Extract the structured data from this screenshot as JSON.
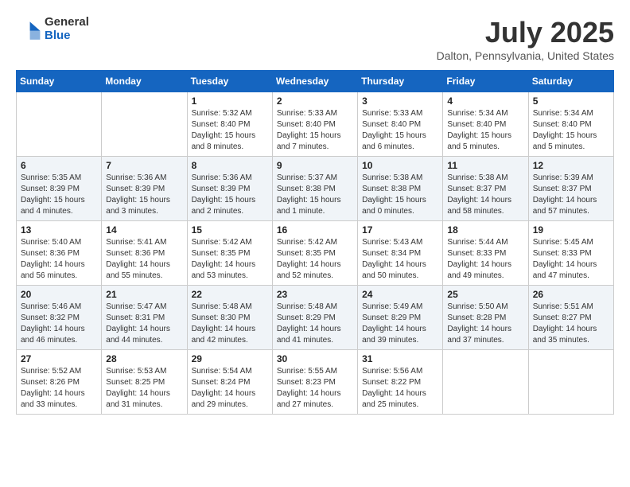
{
  "header": {
    "logo_general": "General",
    "logo_blue": "Blue",
    "month_title": "July 2025",
    "location": "Dalton, Pennsylvania, United States"
  },
  "weekdays": [
    "Sunday",
    "Monday",
    "Tuesday",
    "Wednesday",
    "Thursday",
    "Friday",
    "Saturday"
  ],
  "weeks": [
    [
      {
        "day": "",
        "info": ""
      },
      {
        "day": "",
        "info": ""
      },
      {
        "day": "1",
        "info": "Sunrise: 5:32 AM\nSunset: 8:40 PM\nDaylight: 15 hours and 8 minutes."
      },
      {
        "day": "2",
        "info": "Sunrise: 5:33 AM\nSunset: 8:40 PM\nDaylight: 15 hours and 7 minutes."
      },
      {
        "day": "3",
        "info": "Sunrise: 5:33 AM\nSunset: 8:40 PM\nDaylight: 15 hours and 6 minutes."
      },
      {
        "day": "4",
        "info": "Sunrise: 5:34 AM\nSunset: 8:40 PM\nDaylight: 15 hours and 5 minutes."
      },
      {
        "day": "5",
        "info": "Sunrise: 5:34 AM\nSunset: 8:40 PM\nDaylight: 15 hours and 5 minutes."
      }
    ],
    [
      {
        "day": "6",
        "info": "Sunrise: 5:35 AM\nSunset: 8:39 PM\nDaylight: 15 hours and 4 minutes."
      },
      {
        "day": "7",
        "info": "Sunrise: 5:36 AM\nSunset: 8:39 PM\nDaylight: 15 hours and 3 minutes."
      },
      {
        "day": "8",
        "info": "Sunrise: 5:36 AM\nSunset: 8:39 PM\nDaylight: 15 hours and 2 minutes."
      },
      {
        "day": "9",
        "info": "Sunrise: 5:37 AM\nSunset: 8:38 PM\nDaylight: 15 hours and 1 minute."
      },
      {
        "day": "10",
        "info": "Sunrise: 5:38 AM\nSunset: 8:38 PM\nDaylight: 15 hours and 0 minutes."
      },
      {
        "day": "11",
        "info": "Sunrise: 5:38 AM\nSunset: 8:37 PM\nDaylight: 14 hours and 58 minutes."
      },
      {
        "day": "12",
        "info": "Sunrise: 5:39 AM\nSunset: 8:37 PM\nDaylight: 14 hours and 57 minutes."
      }
    ],
    [
      {
        "day": "13",
        "info": "Sunrise: 5:40 AM\nSunset: 8:36 PM\nDaylight: 14 hours and 56 minutes."
      },
      {
        "day": "14",
        "info": "Sunrise: 5:41 AM\nSunset: 8:36 PM\nDaylight: 14 hours and 55 minutes."
      },
      {
        "day": "15",
        "info": "Sunrise: 5:42 AM\nSunset: 8:35 PM\nDaylight: 14 hours and 53 minutes."
      },
      {
        "day": "16",
        "info": "Sunrise: 5:42 AM\nSunset: 8:35 PM\nDaylight: 14 hours and 52 minutes."
      },
      {
        "day": "17",
        "info": "Sunrise: 5:43 AM\nSunset: 8:34 PM\nDaylight: 14 hours and 50 minutes."
      },
      {
        "day": "18",
        "info": "Sunrise: 5:44 AM\nSunset: 8:33 PM\nDaylight: 14 hours and 49 minutes."
      },
      {
        "day": "19",
        "info": "Sunrise: 5:45 AM\nSunset: 8:33 PM\nDaylight: 14 hours and 47 minutes."
      }
    ],
    [
      {
        "day": "20",
        "info": "Sunrise: 5:46 AM\nSunset: 8:32 PM\nDaylight: 14 hours and 46 minutes."
      },
      {
        "day": "21",
        "info": "Sunrise: 5:47 AM\nSunset: 8:31 PM\nDaylight: 14 hours and 44 minutes."
      },
      {
        "day": "22",
        "info": "Sunrise: 5:48 AM\nSunset: 8:30 PM\nDaylight: 14 hours and 42 minutes."
      },
      {
        "day": "23",
        "info": "Sunrise: 5:48 AM\nSunset: 8:29 PM\nDaylight: 14 hours and 41 minutes."
      },
      {
        "day": "24",
        "info": "Sunrise: 5:49 AM\nSunset: 8:29 PM\nDaylight: 14 hours and 39 minutes."
      },
      {
        "day": "25",
        "info": "Sunrise: 5:50 AM\nSunset: 8:28 PM\nDaylight: 14 hours and 37 minutes."
      },
      {
        "day": "26",
        "info": "Sunrise: 5:51 AM\nSunset: 8:27 PM\nDaylight: 14 hours and 35 minutes."
      }
    ],
    [
      {
        "day": "27",
        "info": "Sunrise: 5:52 AM\nSunset: 8:26 PM\nDaylight: 14 hours and 33 minutes."
      },
      {
        "day": "28",
        "info": "Sunrise: 5:53 AM\nSunset: 8:25 PM\nDaylight: 14 hours and 31 minutes."
      },
      {
        "day": "29",
        "info": "Sunrise: 5:54 AM\nSunset: 8:24 PM\nDaylight: 14 hours and 29 minutes."
      },
      {
        "day": "30",
        "info": "Sunrise: 5:55 AM\nSunset: 8:23 PM\nDaylight: 14 hours and 27 minutes."
      },
      {
        "day": "31",
        "info": "Sunrise: 5:56 AM\nSunset: 8:22 PM\nDaylight: 14 hours and 25 minutes."
      },
      {
        "day": "",
        "info": ""
      },
      {
        "day": "",
        "info": ""
      }
    ]
  ]
}
